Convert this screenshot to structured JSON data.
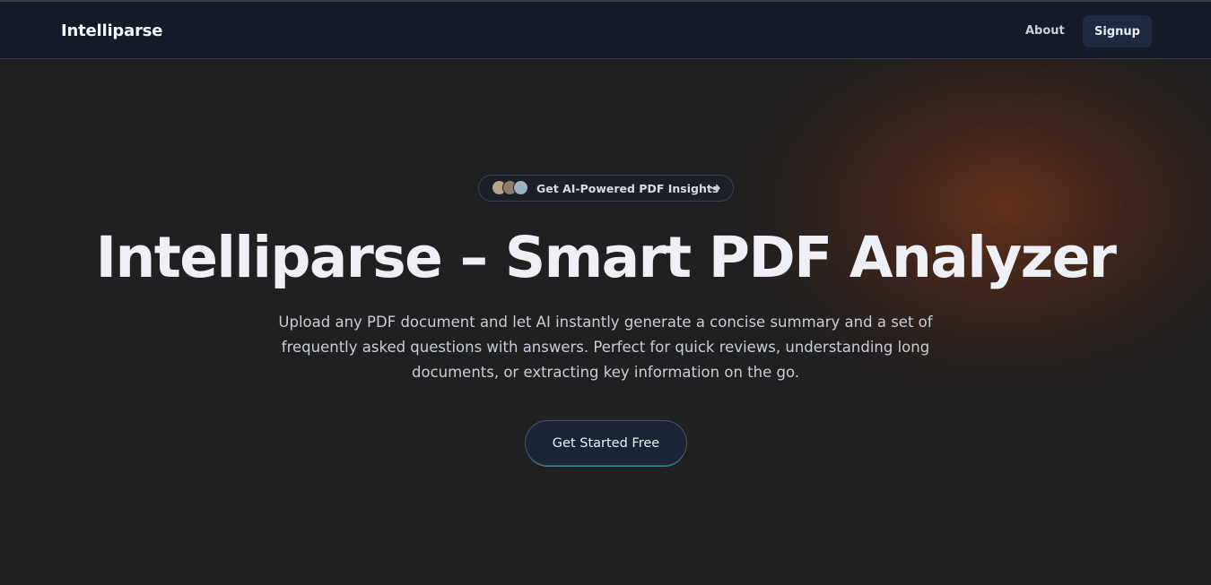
{
  "header": {
    "brand": "Intelliparse",
    "nav": {
      "about_label": "About",
      "signup_label": "Signup"
    }
  },
  "hero": {
    "badge": {
      "label": "Get AI-Powered PDF Insights",
      "icon": "arrow-right-icon",
      "avatars": [
        "avatar-1",
        "avatar-2",
        "avatar-3"
      ]
    },
    "title": "Intelliparse – Smart PDF Analyzer",
    "description": "Upload any PDF document and let AI instantly generate a concise summary and a set of frequently asked questions with answers. Perfect for quick reviews, understanding long documents, or extracting key information on the go.",
    "cta_label": "Get Started Free"
  },
  "colors": {
    "background": "#202020",
    "header_bg": "#141a28",
    "accent_glow": "#6e321c",
    "button_bg": "#1b2436"
  }
}
